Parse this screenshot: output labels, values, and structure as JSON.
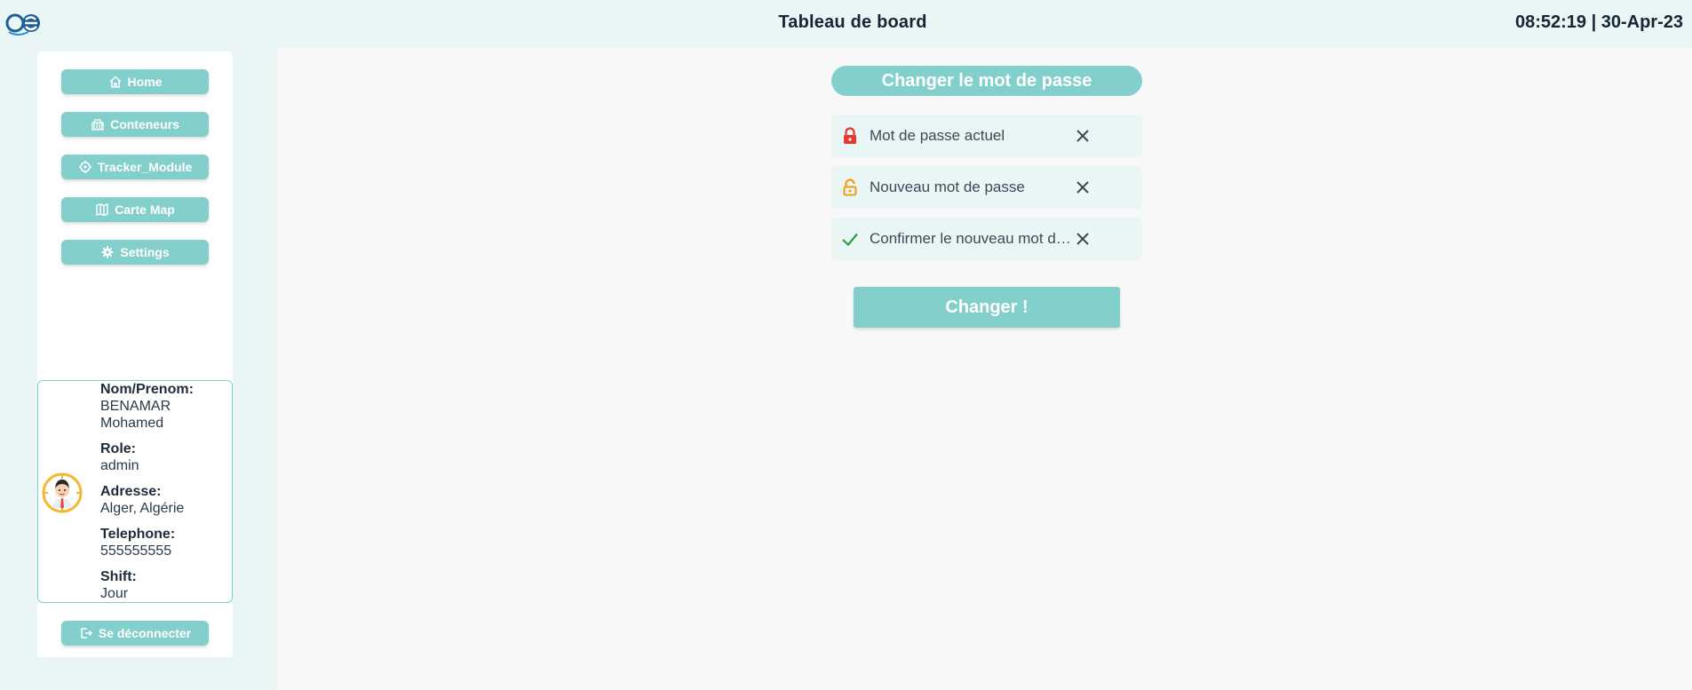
{
  "header": {
    "title": "Tableau de board",
    "clock": "08:52:19 | 30-Apr-23"
  },
  "sidebar": {
    "items": [
      {
        "label": "Home",
        "icon": "home-icon"
      },
      {
        "label": "Conteneurs",
        "icon": "container-icon"
      },
      {
        "label": "Tracker_Module",
        "icon": "tracker-icon"
      },
      {
        "label": "Carte Map",
        "icon": "map-icon"
      },
      {
        "label": "Settings",
        "icon": "gear-icon"
      }
    ],
    "logout_label": "Se déconnecter"
  },
  "profile": {
    "name_label": "Nom/Prenom:",
    "name_value": "BENAMAR Mohamed",
    "role_label": "Role:",
    "role_value": "admin",
    "address_label": "Adresse:",
    "address_value": "Alger, Algérie",
    "phone_label": "Telephone:",
    "phone_value": "555555555",
    "shift_label": "Shift:",
    "shift_value": "Jour"
  },
  "form": {
    "title": "Changer le mot de passe",
    "fields": [
      {
        "placeholder": "Mot de passe actuel",
        "icon": "lock-icon",
        "icon_color": "#e53935"
      },
      {
        "placeholder": "Nouveau mot de passe",
        "icon": "lock-open-icon",
        "icon_color": "#f39c12"
      },
      {
        "placeholder": "Confirmer le nouveau mot de passe",
        "icon": "check-icon",
        "icon_color": "#2e9e44"
      }
    ],
    "submit_label": "Changer !"
  },
  "colors": {
    "accent": "#82cfcb",
    "background": "#eaf5f5",
    "panel": "#f8f8f8"
  }
}
